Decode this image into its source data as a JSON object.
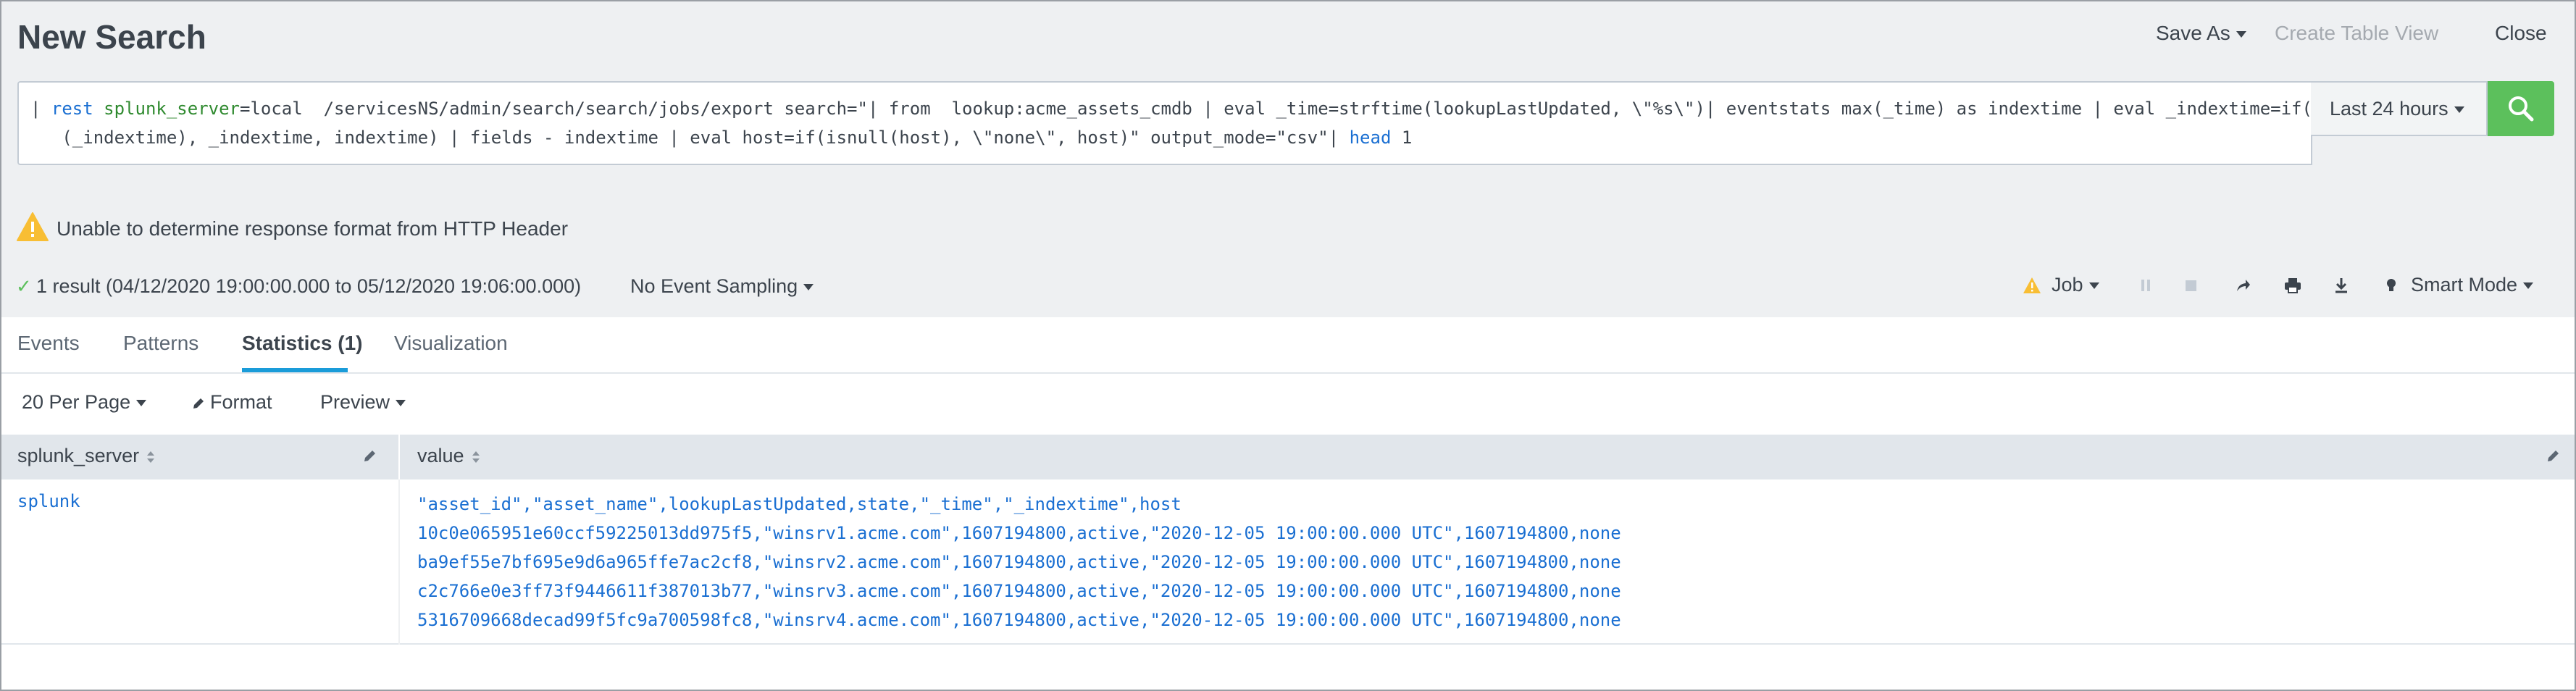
{
  "header": {
    "title": "New Search",
    "save_as": "Save As",
    "create_table_view": "Create Table View",
    "close": "Close"
  },
  "search": {
    "line1_parts": [
      {
        "t": "| ",
        "c": "plain"
      },
      {
        "t": "rest",
        "c": "cmd"
      },
      {
        "t": " ",
        "c": "plain"
      },
      {
        "t": "splunk_server",
        "c": "arg"
      },
      {
        "t": "=local  /servicesNS/admin/search/search/jobs/export search=\"| from  lookup:acme_assets_cmdb | eval _time=strftime(lookupLastUpdated, \\\"%s\\\")| eventstats max(_time) as indextime | eval _indextime=if(isnum",
        "c": "plain"
      }
    ],
    "line2_parts": [
      {
        "t": "   (_indextime), _indextime, indextime) | fields - indextime | eval host=if(isnull(host), \\\"none\\\", host)\" output_mode=\"csv\"| ",
        "c": "plain"
      },
      {
        "t": "head",
        "c": "cmd"
      },
      {
        "t": " 1",
        "c": "plain"
      }
    ],
    "time_range": "Last 24 hours"
  },
  "warning": {
    "message": "Unable to determine response format from HTTP Header"
  },
  "status": {
    "check": "✓",
    "result_summary": "1 result (04/12/2020 19:00:00.000 to 05/12/2020 19:06:00.000)",
    "sampling": "No Event Sampling",
    "job": "Job",
    "mode": "Smart Mode"
  },
  "tabs": [
    {
      "label": "Events"
    },
    {
      "label": "Patterns"
    },
    {
      "label": "Statistics (1)"
    },
    {
      "label": "Visualization"
    }
  ],
  "toolbar": {
    "per_page": "20 Per Page",
    "format": "Format",
    "preview": "Preview"
  },
  "table": {
    "columns": [
      "splunk_server",
      "value"
    ],
    "rows": [
      {
        "splunk_server": "splunk",
        "value": "\"asset_id\",\"asset_name\",lookupLastUpdated,state,\"_time\",\"_indextime\",host\n10c0e065951e60ccf59225013dd975f5,\"winsrv1.acme.com\",1607194800,active,\"2020-12-05 19:00:00.000 UTC\",1607194800,none\nba9ef55e7bf695e9d6a965ffe7ac2cf8,\"winsrv2.acme.com\",1607194800,active,\"2020-12-05 19:00:00.000 UTC\",1607194800,none\nc2c766e0e3ff73f9446611f387013b77,\"winsrv3.acme.com\",1607194800,active,\"2020-12-05 19:00:00.000 UTC\",1607194800,none\n5316709668decad99f5fc9a700598fc8,\"winsrv4.acme.com\",1607194800,active,\"2020-12-05 19:00:00.000 UTC\",1607194800,none"
      }
    ]
  },
  "colors": {
    "accent": "#1a9cd9",
    "search_button": "#5cc05c",
    "warning": "#f8be34",
    "link": "#1a6fd2"
  }
}
